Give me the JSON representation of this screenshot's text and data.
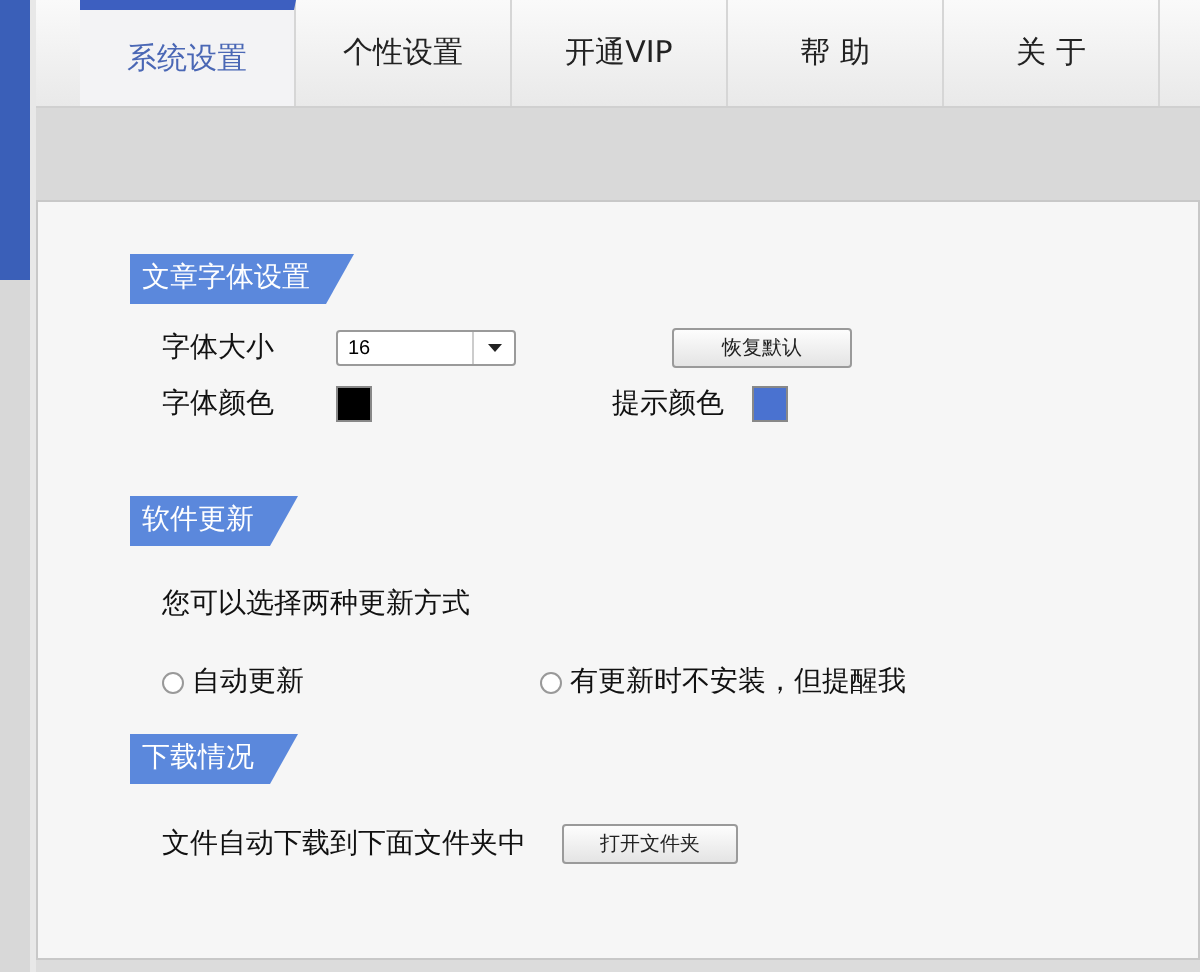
{
  "tabs": [
    {
      "label": "系统设置",
      "selected": true
    },
    {
      "label": "个性设置",
      "selected": false
    },
    {
      "label": "开通VIP",
      "selected": false
    },
    {
      "label": "帮 助",
      "selected": false
    },
    {
      "label": "关 于",
      "selected": false
    }
  ],
  "sections": [
    {
      "title": "文章字体设置",
      "kind": "font",
      "font_size": {
        "label": "字体大小",
        "value": "16"
      },
      "reset_button": "恢复默认",
      "font_color": {
        "label": "字体颜色",
        "color": "#000000"
      },
      "hint_color": {
        "label": "提示颜色",
        "color": "#4a72d0"
      }
    },
    {
      "title": "软件更新",
      "kind": "update",
      "description": "您可以选择两种更新方式",
      "options": [
        {
          "label": "自动更新",
          "selected": false
        },
        {
          "label": "有更新时不安装，但提醒我",
          "selected": false
        }
      ]
    },
    {
      "title": "下载情况",
      "kind": "download",
      "description": "文件自动下载到下面文件夹中",
      "button": "打开文件夹"
    }
  ]
}
